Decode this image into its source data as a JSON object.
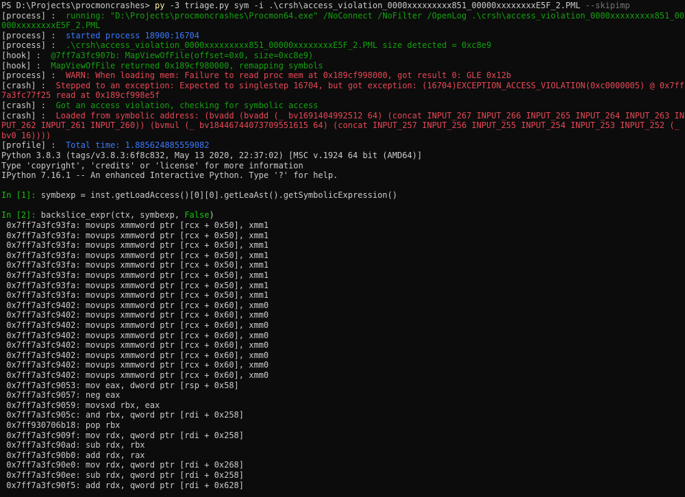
{
  "ps_prompt": {
    "prompt": "PS D:\\Projects\\procmoncrashes> ",
    "cmd_py": "py",
    "cmd_args": " -3 triage.py sym -i .\\crsh\\access_violation_0000xxxxxxxxx851_00000xxxxxxxxE5F_2.PML ",
    "cmd_flag": "--skipimp"
  },
  "log": [
    {
      "tag": "[process]",
      "sep": " :  ",
      "color": "green",
      "text": "running: \"D:\\Projects\\procmoncrashes\\Procmon64.exe\" /NoConnect /NoFilter /OpenLog .\\crsh\\access_violation_0000xxxxxxxxx851_00000xxxxxxxxE5F_2.PML"
    },
    {
      "tag": "[process]",
      "sep": " :  ",
      "color": "blue",
      "text": "started process 18900:16704"
    },
    {
      "tag": "[process]",
      "sep": " :  ",
      "color": "green",
      "text": ".\\crsh\\access_violation_0000xxxxxxxxx851_00000xxxxxxxxE5F_2.PML size detected = 0xc8e9"
    },
    {
      "tag": "[hook]",
      "sep": " :  ",
      "color": "green",
      "text": "@7ff7a3fc907b: MapViewOfFile(offset=0x0, size=0xc8e9)"
    },
    {
      "tag": "[hook]",
      "sep": " :  ",
      "color": "green",
      "text": "MapViewOfFile returned 0x189cf980000, remapping symbols"
    },
    {
      "tag": "[process]",
      "sep": " :  ",
      "color": "red",
      "text": "WARN: When loading mem: Failure to read proc mem at 0x189cf998000, got result 0: GLE 0x12b"
    },
    {
      "tag": "[crash]",
      "sep": " :  ",
      "color": "red",
      "text": "Stepped to an exception: Expected to singlestep 16704, but got exception: (16704)EXCEPTION_ACCESS_VIOLATION(0xc0000005) @ 0x7ff7a3fc77f25 read at 0x189cf998e5f"
    },
    {
      "tag": "[crash]",
      "sep": " :  ",
      "color": "green",
      "text": "Got an access violation, checking for symbolic access"
    },
    {
      "tag": "[crash]",
      "sep": " :  ",
      "color": "red",
      "text": "Loaded from symbolic address: (bvadd (bvadd (_ bv1691404992512 64) (concat INPUT_267 INPUT_266 INPUT_265 INPUT_264 INPUT_263 INPUT_262 INPUT_261 INPUT_260)) (bvmul (_ bv18446744073709551615 64) (concat INPUT_257 INPUT_256 INPUT_255 INPUT_254 INPUT_253 INPUT_252 (_ bv0 16))))"
    },
    {
      "tag": "[profile]",
      "sep": " :  ",
      "color": "blue",
      "text": "Total time: 1.885624885559082"
    }
  ],
  "python_banner": [
    "Python 3.8.3 (tags/v3.8.3:6f8c832, May 13 2020, 22:37:02) [MSC v.1924 64 bit (AMD64)]",
    "Type 'copyright', 'credits' or 'license' for more information",
    "IPython 7.16.1 -- An enhanced Interactive Python. Type '?' for help."
  ],
  "in1": {
    "prompt": "In [1]: ",
    "code": "symbexp = inst.getLoadAccess()[0][0].getLeaAst().getSymbolicExpression()"
  },
  "in2": {
    "prompt": "In [2]: ",
    "code_a": "backslice_expr(ctx, symbexp, ",
    "code_false": "False",
    "code_b": ")"
  },
  "output_lines": [
    " 0x7ff7a3fc93fa: movups xmmword ptr [rcx + 0x50], xmm1",
    " 0x7ff7a3fc93fa: movups xmmword ptr [rcx + 0x50], xmm1",
    " 0x7ff7a3fc93fa: movups xmmword ptr [rcx + 0x50], xmm1",
    " 0x7ff7a3fc93fa: movups xmmword ptr [rcx + 0x50], xmm1",
    " 0x7ff7a3fc93fa: movups xmmword ptr [rcx + 0x50], xmm1",
    " 0x7ff7a3fc93fa: movups xmmword ptr [rcx + 0x50], xmm1",
    " 0x7ff7a3fc93fa: movups xmmword ptr [rcx + 0x50], xmm1",
    " 0x7ff7a3fc93fa: movups xmmword ptr [rcx + 0x50], xmm1",
    " 0x7ff7a3fc9402: movups xmmword ptr [rcx + 0x60], xmm0",
    " 0x7ff7a3fc9402: movups xmmword ptr [rcx + 0x60], xmm0",
    " 0x7ff7a3fc9402: movups xmmword ptr [rcx + 0x60], xmm0",
    " 0x7ff7a3fc9402: movups xmmword ptr [rcx + 0x60], xmm0",
    " 0x7ff7a3fc9402: movups xmmword ptr [rcx + 0x60], xmm0",
    " 0x7ff7a3fc9402: movups xmmword ptr [rcx + 0x60], xmm0",
    " 0x7ff7a3fc9402: movups xmmword ptr [rcx + 0x60], xmm0",
    " 0x7ff7a3fc9402: movups xmmword ptr [rcx + 0x60], xmm0",
    " 0x7ff7a3fc9053: mov eax, dword ptr [rsp + 0x58]",
    " 0x7ff7a3fc9057: neg eax",
    " 0x7ff7a3fc9059: movsxd rbx, eax",
    " 0x7ff7a3fc905c: and rbx, qword ptr [rdi + 0x258]",
    " 0x7ff930706b18: pop rbx",
    " 0x7ff7a3fc909f: mov rdx, qword ptr [rdi + 0x258]",
    " 0x7ff7a3fc90ad: sub rdx, rbx",
    " 0x7ff7a3fc90b0: add rdx, rax",
    " 0x7ff7a3fc90e0: mov rdx, qword ptr [rdi + 0x268]",
    " 0x7ff7a3fc90ee: sub rdx, qword ptr [rdi + 0x258]",
    " 0x7ff7a3fc90f5: add rdx, qword ptr [rdi + 0x628]"
  ],
  "colors": {
    "background": "#0c0c0c",
    "text": "#cccccc",
    "green": "#13a10e",
    "red": "#e74856",
    "blue": "#3b78ff",
    "yellow": "#f9f1a5",
    "gray": "#767676"
  }
}
